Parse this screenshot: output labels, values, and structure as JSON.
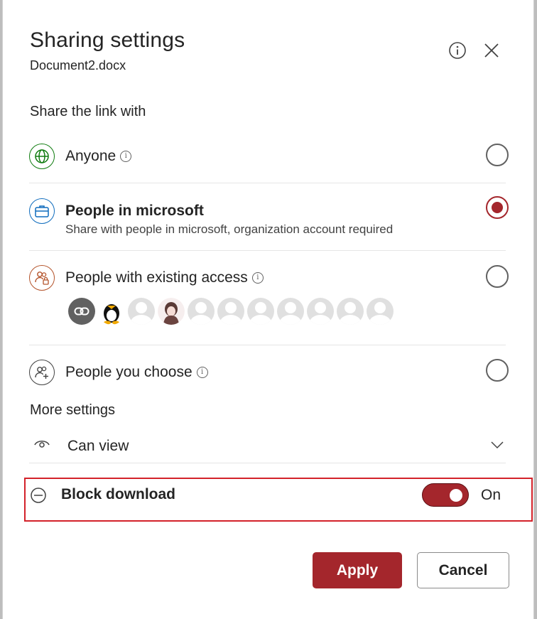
{
  "header": {
    "title": "Sharing settings",
    "filename": "Document2.docx",
    "info_icon": "info-icon",
    "close_icon": "close-icon"
  },
  "share_section": {
    "heading": "Share the link with",
    "options": [
      {
        "label": "Anyone",
        "icon": "globe-icon",
        "has_info": true,
        "selected": false
      },
      {
        "label": "People in microsoft",
        "sublabel": "Share with people in microsoft, organization account required",
        "icon": "briefcase-icon",
        "selected": true
      },
      {
        "label": "People with existing access",
        "icon": "people-lock-icon",
        "has_info": true,
        "selected": false
      },
      {
        "label": "People you choose",
        "icon": "people-add-icon",
        "has_info": true,
        "selected": false
      }
    ]
  },
  "more_settings": {
    "heading": "More settings",
    "permission": {
      "label": "Can view",
      "icon": "eye-icon"
    },
    "block_download": {
      "label": "Block download",
      "state_label": "On",
      "enabled": true
    }
  },
  "buttons": {
    "apply": "Apply",
    "cancel": "Cancel"
  },
  "colors": {
    "accent": "#a4262c",
    "highlight_border": "#d3222a",
    "globe": "#107c10",
    "briefcase": "#0f6cbd",
    "people_lock": "#b4532a"
  }
}
